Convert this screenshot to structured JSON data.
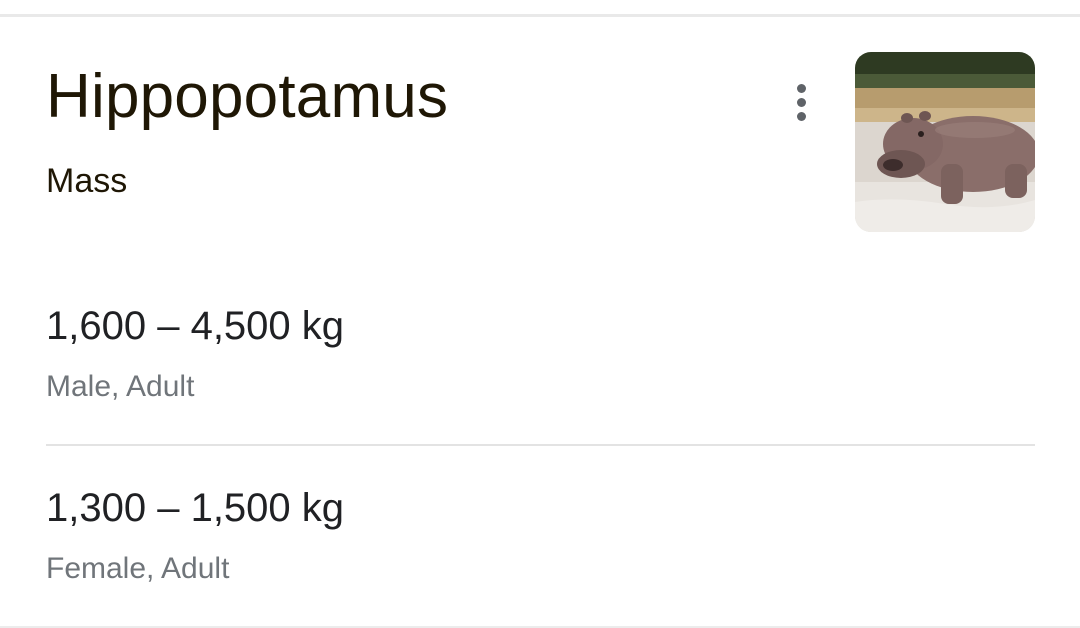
{
  "card": {
    "title": "Hippopotamus",
    "subtitle": "Mass",
    "menu_icon": "more-vert-icon",
    "image_subject": "hippopotamus-photo"
  },
  "entries": [
    {
      "value": "1,600 – 4,500 kg",
      "qualifier": "Male, Adult"
    },
    {
      "value": "1,300 – 1,500 kg",
      "qualifier": "Female, Adult"
    }
  ],
  "colors": {
    "title": "#1f1705",
    "value": "#202124",
    "qualifier": "#70757a",
    "divider": "#e3e3e3"
  }
}
